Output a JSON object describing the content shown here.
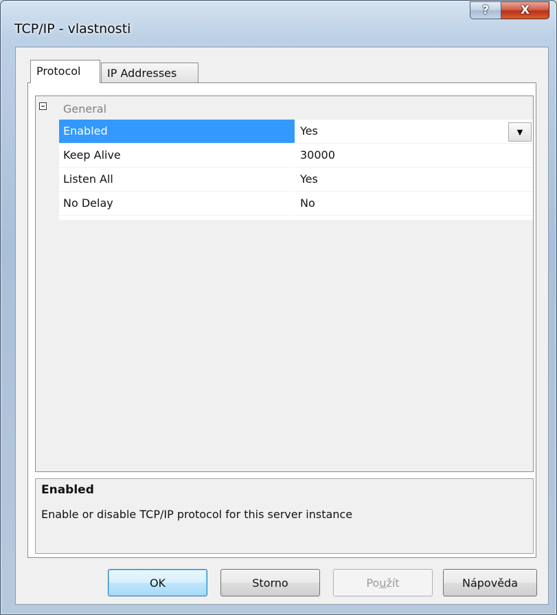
{
  "window": {
    "title": "TCP/IP - vlastnosti",
    "help_glyph": "?",
    "close_glyph": "X"
  },
  "tabs": [
    {
      "label": "Protocol",
      "selected": true
    },
    {
      "label": "IP Addresses",
      "selected": false
    }
  ],
  "property_grid": {
    "category": "General",
    "rows": [
      {
        "name": "Enabled",
        "value": "Yes",
        "selected": true
      },
      {
        "name": "Keep Alive",
        "value": "30000",
        "selected": false
      },
      {
        "name": "Listen All",
        "value": "Yes",
        "selected": false
      },
      {
        "name": "No Delay",
        "value": "No",
        "selected": false
      }
    ]
  },
  "description": {
    "title": "Enabled",
    "text": "Enable or disable TCP/IP protocol for this server instance"
  },
  "buttons": {
    "ok": "OK",
    "cancel": "Storno",
    "apply_pre": "Po",
    "apply_u": "u",
    "apply_post": "žít",
    "help": "Nápověda"
  },
  "colors": {
    "selection": "#3399ff",
    "close_button": "#c4421f"
  }
}
